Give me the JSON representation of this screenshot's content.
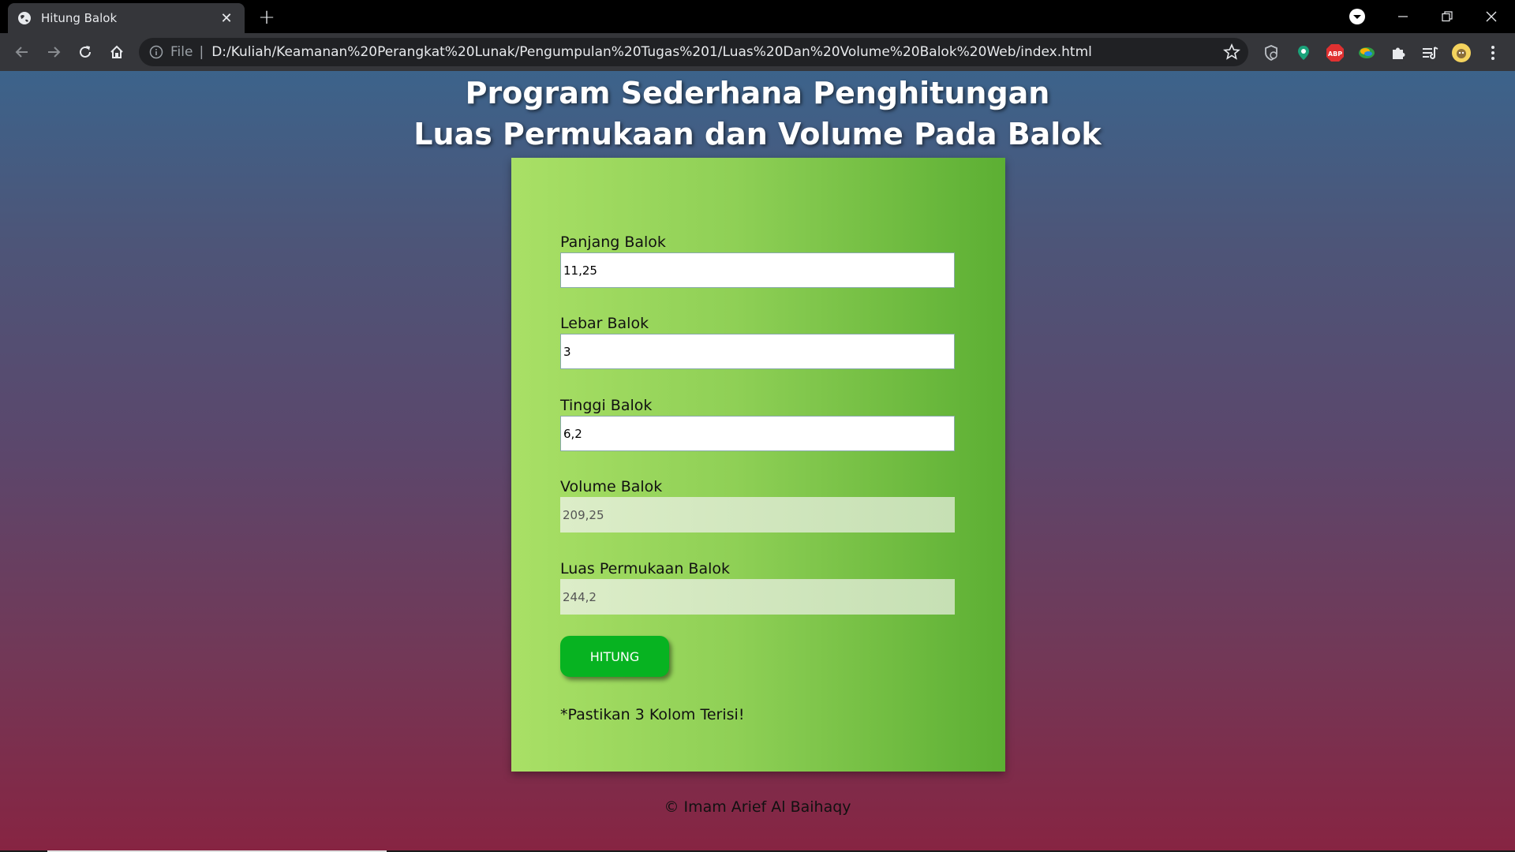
{
  "browser": {
    "tab_title": "Hitung Balok",
    "address_scheme": "File",
    "address_url": "D:/Kuliah/Keamanan%20Perangkat%20Lunak/Pengumpulan%20Tugas%201/Luas%20Dan%20Volume%20Balok%20Web/index.html",
    "extensions": [
      "shield-extension",
      "location-extension",
      "adblock-plus",
      "color-extension",
      "extensions-puzzle",
      "reading-list",
      "profile-avatar"
    ],
    "abp_label": "ABP"
  },
  "page": {
    "heading_line1": "Program Sederhana Penghitungan",
    "heading_line2": "Luas Permukaan dan Volume Pada Balok",
    "fields": {
      "panjang": {
        "label": "Panjang Balok",
        "value": "11,25"
      },
      "lebar": {
        "label": "Lebar Balok",
        "value": "3"
      },
      "tinggi": {
        "label": "Tinggi Balok",
        "value": "6,2"
      },
      "volume": {
        "label": "Volume Balok",
        "value": "209,25"
      },
      "luas": {
        "label": "Luas Permukaan Balok",
        "value": "244,2"
      }
    },
    "button_label": "HITUNG",
    "note": "*Pastikan 3 Kolom Terisi!",
    "footer": "© Imam Arief Al Baihaqy"
  }
}
